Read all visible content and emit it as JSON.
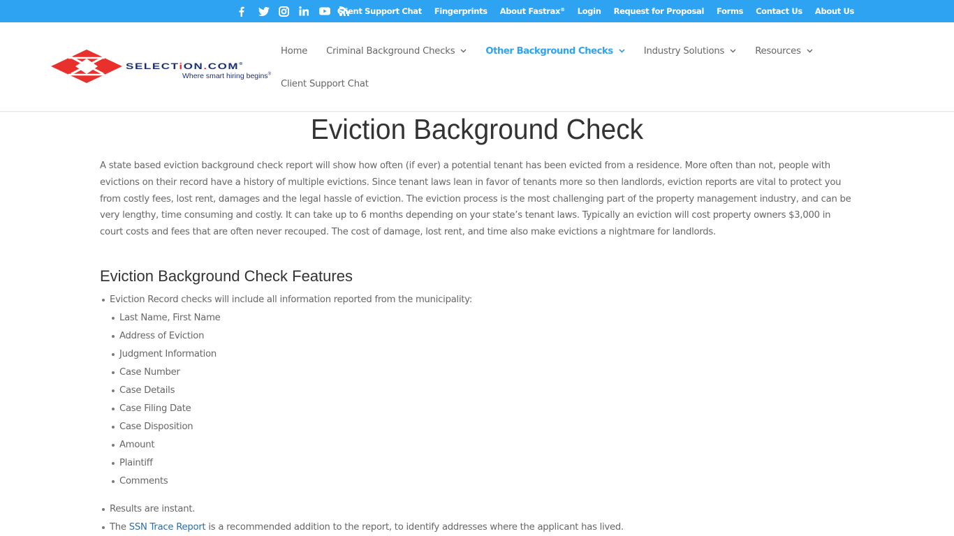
{
  "colors": {
    "top_bar": "#2ea3f2",
    "accent": "#2ea3f2",
    "text": "#666666",
    "heading": "#333333",
    "link": "#2e6da8",
    "logo_red": "#e8302d",
    "logo_navy": "#1c2f7a"
  },
  "top_bar": {
    "social_icons": [
      "facebook-icon",
      "twitter-icon",
      "instagram-icon",
      "linkedin-icon",
      "youtube-icon",
      "rss-icon"
    ],
    "links": [
      {
        "label": "Client Support Chat"
      },
      {
        "label": "Fingerprints"
      },
      {
        "label": "About Fastrax",
        "sup": "®"
      },
      {
        "label": "Login"
      },
      {
        "label": "Request for Proposal"
      },
      {
        "label": "Forms"
      },
      {
        "label": "Contact Us"
      },
      {
        "label": "About Us"
      }
    ]
  },
  "logo": {
    "wordmark_pre": "SELECT",
    "wordmark_i": "i",
    "wordmark_mid": "ON",
    "wordmark_dot": ".",
    "wordmark_post": "COM",
    "reg": "®",
    "tagline": "Where smart hiring begins",
    "tagline_reg": "®"
  },
  "main_nav": {
    "items": [
      {
        "label": "Home",
        "dropdown": false,
        "active": false
      },
      {
        "label": "Criminal Background Checks",
        "dropdown": true,
        "active": false
      },
      {
        "label": "Other Background Checks",
        "dropdown": true,
        "active": true
      },
      {
        "label": "Industry Solutions",
        "dropdown": true,
        "active": false
      },
      {
        "label": "Resources",
        "dropdown": true,
        "active": false
      },
      {
        "label": "Client Support Chat",
        "dropdown": false,
        "active": false
      }
    ]
  },
  "page": {
    "title": "Eviction Background Check",
    "intro": "A state based eviction background check report will show how often (if ever) a potential tenant has been evicted from a residence. More often than not, people with evictions on their record have a history of multiple evictions. Since tenant laws lean in favor of tenants more so then landlords, eviction reports are vital to protect you from costly fees, lost rent, damages and the legal hassle of eviction. The eviction process is the most challenging part of the property management industry, and can be very lengthy, time consuming and costly. It can take up to 6 months depending on your state’s tenant laws. Typically an eviction will cost property owners $3,000 in court costs and fees that are often never recouped. The cost of damage, lost rent, and time also make evictions a nightmare for landlords.",
    "features_heading": "Eviction Background Check Features",
    "features": {
      "lead": "Eviction Record checks will include all information reported from the municipality:",
      "sub_items": [
        "Last Name, First Name",
        "Address of Eviction",
        "Judgment Information",
        "Case Number",
        "Case Details",
        "Case Filing Date",
        "Case Disposition",
        "Amount",
        "Plaintiff",
        "Comments"
      ],
      "results": "Results are instant.",
      "ssn_pre": "The ",
      "ssn_link": "SSN Trace Report",
      "ssn_post": " is a recommended addition to the report, to identify addresses where the applicant has lived."
    }
  }
}
